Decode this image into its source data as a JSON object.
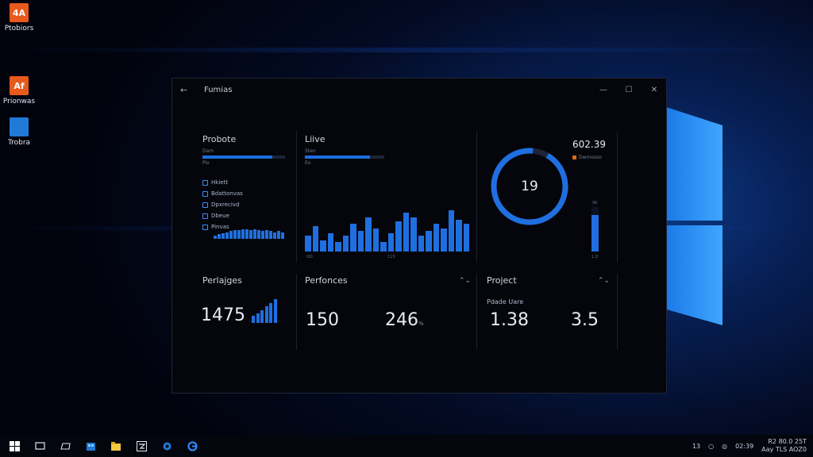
{
  "desktop": {
    "icons": [
      {
        "glyph": "4A",
        "label": "Ptobiors",
        "color": "#e85a1c"
      },
      {
        "glyph": "Af",
        "label": "Prionwas",
        "color": "#e85a1c"
      },
      {
        "glyph": "",
        "label": "Trobra",
        "color": "#1f7ad8"
      }
    ]
  },
  "window": {
    "back_glyph": "←",
    "title": "Fumias",
    "minimize_glyph": "—",
    "maximize_glyph": "☐",
    "close_glyph": "✕"
  },
  "panel_products": {
    "title": "Probote",
    "sub_label": "Dam",
    "sub_value": "Pio",
    "progress": 0.85,
    "items": [
      "Hkiett",
      "Bdattonvas",
      "Dpxrecivd",
      "Dbeue",
      "Pinvas"
    ],
    "chart_values": [
      3,
      5,
      6,
      7,
      8,
      9,
      9,
      10,
      10,
      9,
      10,
      9,
      8,
      9,
      8,
      7,
      8,
      7
    ]
  },
  "panel_line": {
    "title": "Liive",
    "sub_label": "Sten",
    "sub_value": "Eo",
    "progress": 0.82,
    "axis_left": "OD",
    "axis_mid": "115",
    "chart_values": [
      14,
      22,
      10,
      16,
      8,
      14,
      24,
      18,
      30,
      20,
      8,
      16,
      26,
      34,
      30,
      14,
      18,
      24,
      20,
      36,
      28,
      24
    ]
  },
  "panel_gauge": {
    "value_label": "19",
    "gauge_fraction": 0.93,
    "top_value": "602.39",
    "legend_label": "Dwmosso",
    "bar_top_label": "96",
    "bar_bottom_label": "1.D",
    "bar_fraction": 0.82
  },
  "panel_packages": {
    "title": "Perlajges",
    "value": "1475",
    "chart_values": [
      4,
      5,
      7,
      9,
      11,
      13
    ]
  },
  "panel_performance": {
    "title": "Perfonces",
    "chevron": "⌃⌄",
    "value_a": "150",
    "value_b": "246",
    "value_b_unit": "%"
  },
  "panel_project": {
    "title": "Project",
    "chevron": "⌃⌄",
    "sub_label": "Pdade Uare",
    "value_a": "1.38",
    "value_b": "3.5"
  },
  "taskbar": {
    "tray_text_1": "13",
    "tray_text_2": "02:39",
    "clock_line_1": "R2 80.0 25T",
    "clock_line_2": "Aay TLS AOZ0"
  }
}
